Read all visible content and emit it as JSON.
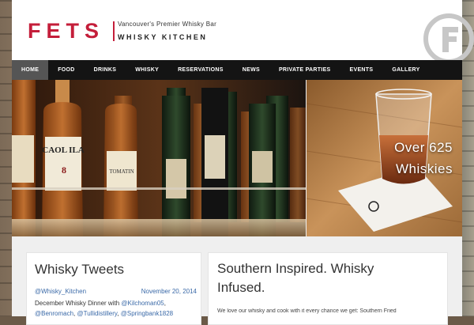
{
  "header": {
    "logo_text": "FETS",
    "tagline": "Vancouver's Premier Whisky Bar",
    "subtitle": "WHISKY KITCHEN"
  },
  "nav": {
    "items": [
      {
        "label": "Home",
        "active": true
      },
      {
        "label": "Food"
      },
      {
        "label": "Drinks"
      },
      {
        "label": "Whisky"
      },
      {
        "label": "Reservations"
      },
      {
        "label": "News"
      },
      {
        "label": "Private Parties"
      },
      {
        "label": "Events"
      },
      {
        "label": "Gallery"
      }
    ]
  },
  "hero": {
    "caption_line1": "Over 625",
    "caption_line2": "Whiskies",
    "bottle_labels": [
      "CAOL ILA",
      "8",
      "TOMATIN"
    ]
  },
  "tweets": {
    "title": "Whisky Tweets",
    "user": "@Whisky_Kitchen",
    "date": "November 20, 2014",
    "text_start": "December Whisky Dinner with ",
    "mentions": [
      "@Kilchoman05",
      "@Benromach",
      "@Tullidistillery",
      "@Springbank1828"
    ]
  },
  "intro": {
    "title": "Southern Inspired. Whisky Infused.",
    "text": "We love our whisky and cook with it every chance we get: Southern Fried"
  },
  "colors": {
    "brand_red": "#c41e3a",
    "nav_bg": "#141414",
    "nav_active": "#555555",
    "link_blue": "#3b6aa8"
  }
}
